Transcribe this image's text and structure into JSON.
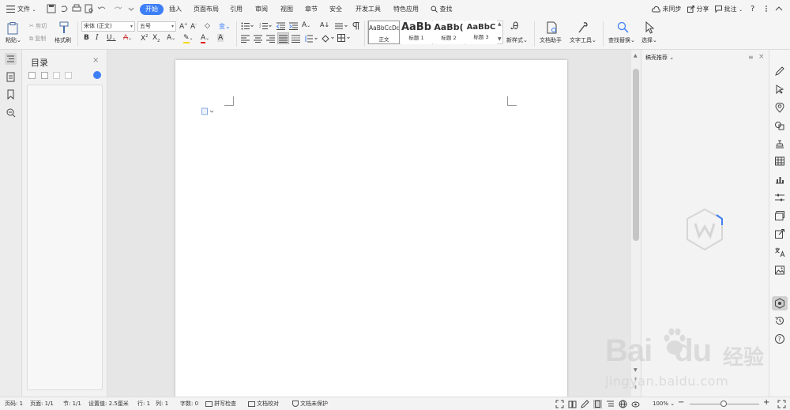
{
  "menubar": {
    "file_label": "文件",
    "tabs": [
      {
        "label": "开始",
        "active": true
      },
      {
        "label": "插入"
      },
      {
        "label": "页面布局"
      },
      {
        "label": "引用"
      },
      {
        "label": "审阅"
      },
      {
        "label": "视图"
      },
      {
        "label": "章节"
      },
      {
        "label": "安全"
      },
      {
        "label": "开发工具"
      },
      {
        "label": "特色应用"
      }
    ],
    "search_label": "查找",
    "sync_label": "未同步",
    "share_label": "分享",
    "comment_label": "批注",
    "help_label": "?"
  },
  "ribbon": {
    "paste_label": "粘贴",
    "cut_label": "剪切",
    "copy_label": "复制",
    "format_painter_label": "格式刷",
    "font_name": "宋体 (正文)",
    "font_size": "五号",
    "styles": [
      {
        "sample": "AaBbCcDd",
        "name": "正文"
      },
      {
        "sample": "AaBb",
        "name": "标题 1"
      },
      {
        "sample": "AaBb(",
        "name": "标题 2"
      },
      {
        "sample": "AaBbC",
        "name": "标题 3"
      }
    ],
    "new_style_label": "新样式",
    "doc_assistant_label": "文档助手",
    "text_tools_label": "文字工具",
    "find_replace_label": "查找替换",
    "select_label": "选择"
  },
  "toc": {
    "title": "目录"
  },
  "right_panel": {
    "title": "稿壳推荐"
  },
  "statusbar": {
    "page_num": "页码: 1",
    "page_count": "页面: 1/1",
    "section": "节: 1/1",
    "position": "设置值: 2.5厘米",
    "line": "行: 1",
    "column": "列: 1",
    "word_count": "字数: 0",
    "spell_check": "拼写检查",
    "doc_proof": "文档校对",
    "doc_protect": "文档未保护",
    "zoom": "100%"
  },
  "watermark": {
    "brand": "Bai",
    "brand2": "du",
    "brand_cn": "经验",
    "url": "jingyan.baidu.com"
  },
  "colors": {
    "accent": "#3d7ff6",
    "baidu_red": "#d9d9d9"
  }
}
